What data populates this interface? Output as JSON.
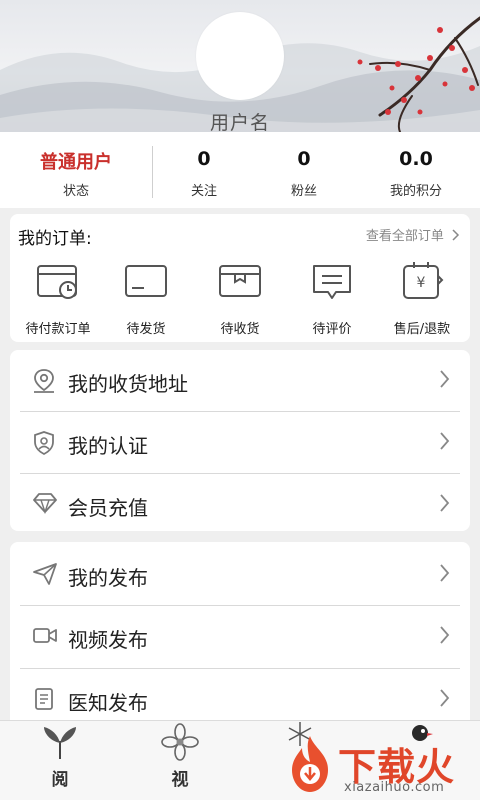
{
  "profile": {
    "username": "用户名"
  },
  "stats": [
    {
      "value": "普通用户",
      "label": "状态"
    },
    {
      "value": "0",
      "label": "关注"
    },
    {
      "value": "0",
      "label": "粉丝"
    },
    {
      "value": "0.0",
      "label": "我的积分"
    }
  ],
  "orders": {
    "title": "我的订单:",
    "view_all": "查看全部订单",
    "items": [
      {
        "label": "待付款订单",
        "icon": "wallet-clock-icon"
      },
      {
        "label": "待发货",
        "icon": "card-icon"
      },
      {
        "label": "待收货",
        "icon": "box-icon"
      },
      {
        "label": "待评价",
        "icon": "chat-icon"
      },
      {
        "label": "售后/退款",
        "icon": "refund-icon"
      }
    ]
  },
  "menu1": [
    {
      "label": "我的收货地址",
      "icon": "location-icon"
    },
    {
      "label": "我的认证",
      "icon": "shield-icon"
    },
    {
      "label": "会员充值",
      "icon": "diamond-icon"
    }
  ],
  "menu2": [
    {
      "label": "我的发布",
      "icon": "send-icon"
    },
    {
      "label": "视频发布",
      "icon": "video-icon"
    },
    {
      "label": "医知发布",
      "icon": "document-icon"
    }
  ],
  "tabbar": [
    {
      "label": "阅",
      "icon": "leaf-icon"
    },
    {
      "label": "视",
      "icon": "flower-icon"
    },
    {
      "label": "",
      "icon": "snowflake-icon"
    },
    {
      "label": "",
      "icon": "bird-icon"
    }
  ],
  "watermark": {
    "text": "下载火",
    "url": "xiazaihuo.com"
  },
  "colors": {
    "accent_red": "#c9302c",
    "watermark_orange": "#e0462a"
  }
}
